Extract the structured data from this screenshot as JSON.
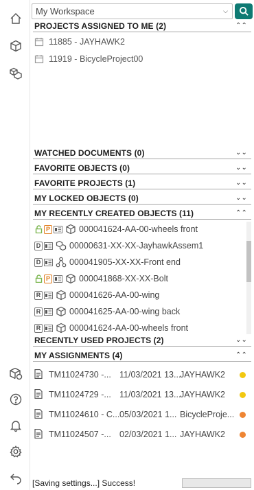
{
  "workspace": {
    "selected": "My Workspace"
  },
  "sections": {
    "projects_assigned": "PROJECTS ASSIGNED TO ME (2)",
    "watched_documents": "WATCHED DOCUMENTS (0)",
    "favorite_objects": "FAVORITE OBJECTS (0)",
    "favorite_projects": "FAVORITE PROJECTS (1)",
    "locked_objects": "MY LOCKED OBJECTS (0)",
    "recently_created": "MY RECENTLY CREATED OBJECTS (11)",
    "recently_used_projects": "RECENTLY USED PROJECTS (2)",
    "my_assignments": "MY ASSIGNMENTS (4)"
  },
  "projects": [
    {
      "label": "11885 - JAYHAWK2"
    },
    {
      "label": "11919 - BicycleProject00"
    }
  ],
  "recent_objects": [
    {
      "label": "000041624-AA-00-wheels front",
      "badge": "P",
      "locked": true,
      "icon": "cube-icon"
    },
    {
      "label": "00000631-XX-XX-JayhawkAssem1",
      "badge": "D",
      "locked": false,
      "icon": "assembly-icon"
    },
    {
      "label": "000041905-XX-XX-Front end",
      "badge": "D",
      "locked": false,
      "icon": "structure-icon"
    },
    {
      "label": "000041868-XX-XX-Bolt",
      "badge": "P",
      "locked": true,
      "icon": "cube-icon"
    },
    {
      "label": "000041626-AA-00-wing",
      "badge": "R",
      "locked": false,
      "icon": "cube-icon"
    },
    {
      "label": "000041625-AA-00-wing back",
      "badge": "R",
      "locked": false,
      "icon": "cube-icon"
    },
    {
      "label": "000041624-AA-00-wheels front",
      "badge": "R",
      "locked": false,
      "icon": "cube-icon"
    }
  ],
  "assignments": [
    {
      "id": "TM11024730 -...",
      "date": "11/03/2021 13...",
      "owner": "JAYHAWK2",
      "status_color": "#f2c811"
    },
    {
      "id": "TM11024729 -...",
      "date": "11/03/2021 13...",
      "owner": "JAYHAWK2",
      "status_color": "#f2c811"
    },
    {
      "id": "TM11024610 - C...",
      "date": "05/03/2021 1...",
      "owner": "BicycleProje...",
      "status_color": "#ee8533"
    },
    {
      "id": "TM11024507 -...",
      "date": "02/03/2021 1...",
      "owner": "JAYHAWK2",
      "status_color": "#ee8533"
    }
  ],
  "status": {
    "message": "[Saving settings...] Success!"
  }
}
